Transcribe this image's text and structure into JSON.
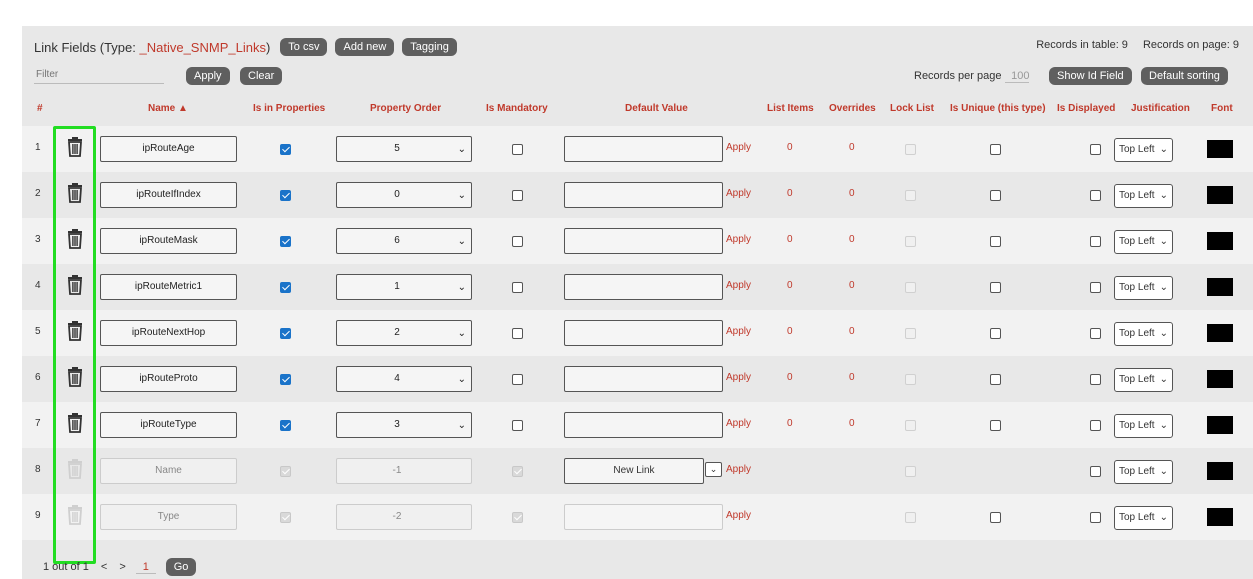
{
  "header": {
    "title_prefix": "Link Fields (Type: ",
    "type_name": "_Native_SNMP_Links",
    "title_suffix": ")",
    "buttons": {
      "to_csv": "To csv",
      "add_new": "Add new",
      "tagging": "Tagging"
    },
    "records_in_table": "Records in table: 9",
    "records_on_page": "Records on page: 9"
  },
  "filter": {
    "placeholder": "Filter",
    "apply": "Apply",
    "clear": "Clear",
    "records_per_page_label": "Records per page",
    "records_per_page_value": "100",
    "show_id_field": "Show Id Field",
    "default_sorting": "Default sorting"
  },
  "columns": {
    "idx": "#",
    "name": "Name ▲",
    "is_in_properties": "Is in Properties",
    "property_order": "Property Order",
    "is_mandatory": "Is Mandatory",
    "default_value": "Default Value",
    "list_items": "List Items",
    "overrides": "Overrides",
    "lock_list": "Lock List",
    "is_unique": "Is Unique (this type)",
    "is_displayed": "Is Displayed",
    "justification": "Justification",
    "font": "Font"
  },
  "rows": [
    {
      "idx": "1",
      "name": "ipRouteAge",
      "order": "5",
      "default": "",
      "apply": "Apply",
      "list_items": "0",
      "overrides": "0",
      "just": "Top Left"
    },
    {
      "idx": "2",
      "name": "ipRouteIfIndex",
      "order": "0",
      "default": "",
      "apply": "Apply",
      "list_items": "0",
      "overrides": "0",
      "just": "Top Left"
    },
    {
      "idx": "3",
      "name": "ipRouteMask",
      "order": "6",
      "default": "",
      "apply": "Apply",
      "list_items": "0",
      "overrides": "0",
      "just": "Top Left"
    },
    {
      "idx": "4",
      "name": "ipRouteMetric1",
      "order": "1",
      "default": "",
      "apply": "Apply",
      "list_items": "0",
      "overrides": "0",
      "just": "Top Left"
    },
    {
      "idx": "5",
      "name": "ipRouteNextHop",
      "order": "2",
      "default": "",
      "apply": "Apply",
      "list_items": "0",
      "overrides": "0",
      "just": "Top Left"
    },
    {
      "idx": "6",
      "name": "ipRouteProto",
      "order": "4",
      "default": "",
      "apply": "Apply",
      "list_items": "0",
      "overrides": "0",
      "just": "Top Left"
    },
    {
      "idx": "7",
      "name": "ipRouteType",
      "order": "3",
      "default": "",
      "apply": "Apply",
      "list_items": "0",
      "overrides": "0",
      "just": "Top Left"
    },
    {
      "idx": "8",
      "name": "Name",
      "order": "-1",
      "default": "New Link",
      "apply": "Apply",
      "just": "Top Left"
    },
    {
      "idx": "9",
      "name": "Type",
      "order": "-2",
      "default": "",
      "apply": "Apply",
      "just": "Top Left"
    }
  ],
  "pager": {
    "summary": "1 out of 1",
    "prev": "<",
    "next": ">",
    "page": "1",
    "go": "Go"
  },
  "icons": {
    "delete": "trash-icon",
    "dropdown": "chevron-down-icon"
  },
  "colors": {
    "accent": "#c0392b",
    "button": "#5f5f5f",
    "checkbox": "#1a73c9",
    "highlight": "#22dd22"
  }
}
